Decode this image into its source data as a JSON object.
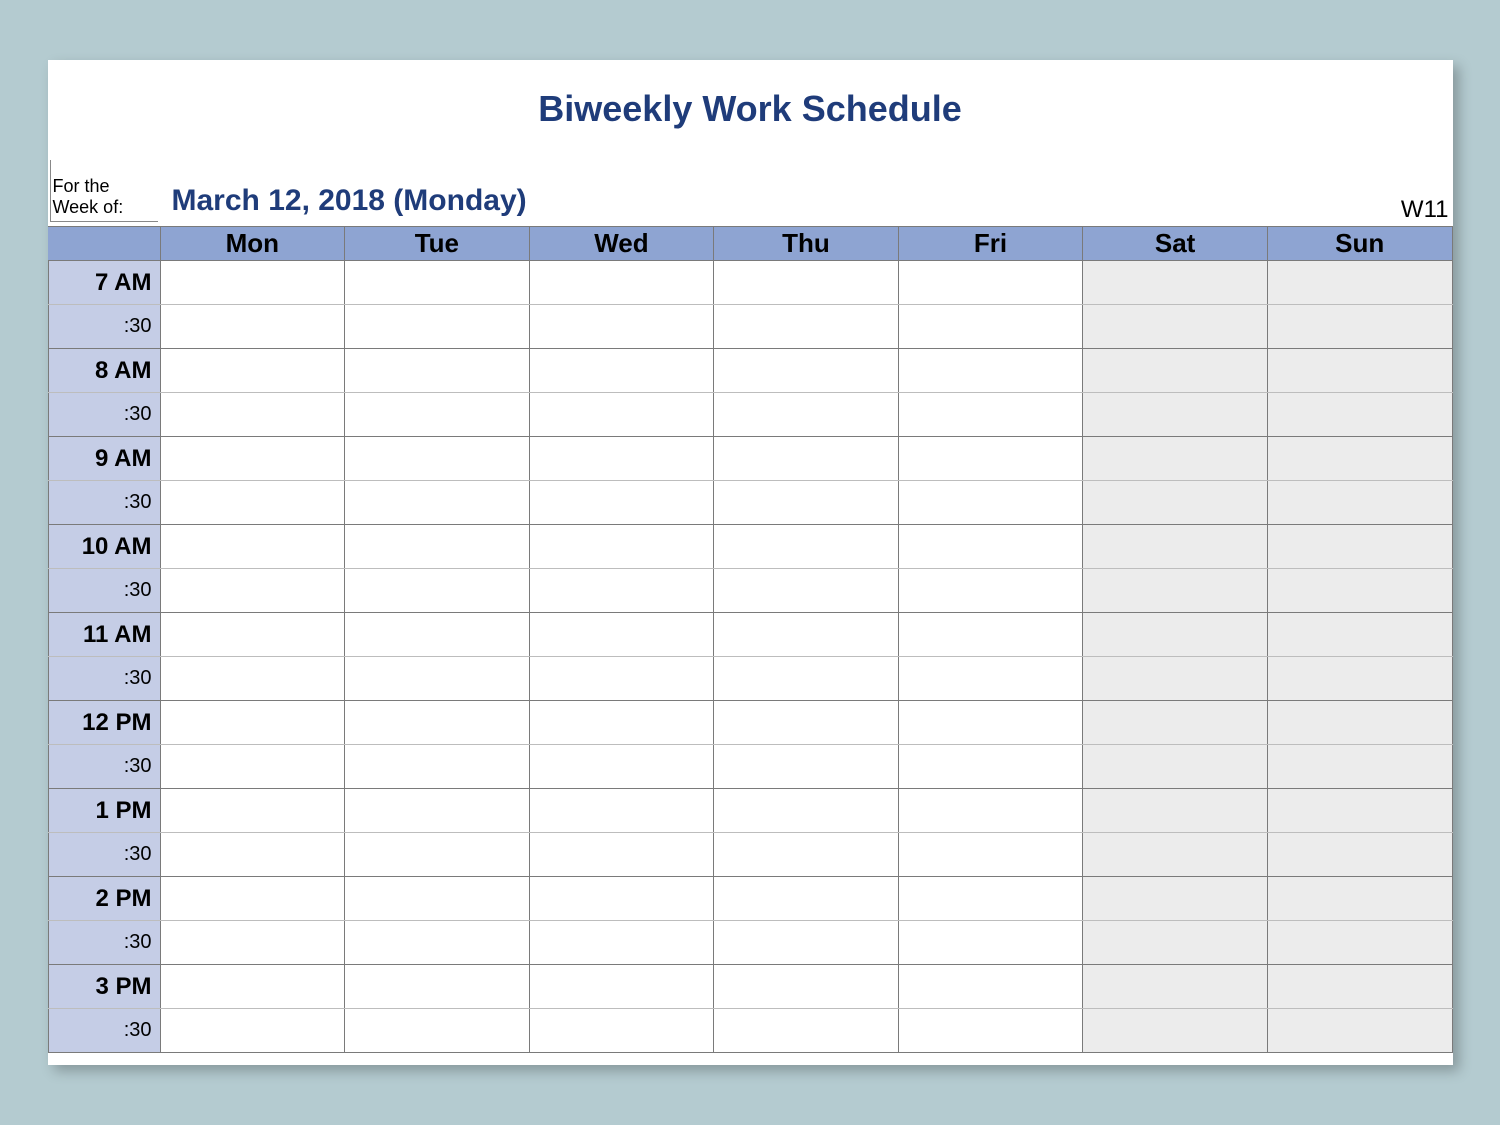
{
  "title": "Biweekly Work Schedule",
  "meta": {
    "label": "For the Week of:",
    "date": "March 12, 2018 (Monday)",
    "week_number": "W11"
  },
  "days": [
    "Mon",
    "Tue",
    "Wed",
    "Thu",
    "Fri",
    "Sat",
    "Sun"
  ],
  "weekend_indices": [
    5,
    6
  ],
  "time_slots": [
    {
      "hour": "7 AM",
      "half": ":30"
    },
    {
      "hour": "8 AM",
      "half": ":30"
    },
    {
      "hour": "9 AM",
      "half": ":30"
    },
    {
      "hour": "10 AM",
      "half": ":30"
    },
    {
      "hour": "11 AM",
      "half": ":30"
    },
    {
      "hour": "12 PM",
      "half": ":30"
    },
    {
      "hour": "1 PM",
      "half": ":30"
    },
    {
      "hour": "2 PM",
      "half": ":30"
    },
    {
      "hour": "3 PM",
      "half": ":30"
    }
  ]
}
